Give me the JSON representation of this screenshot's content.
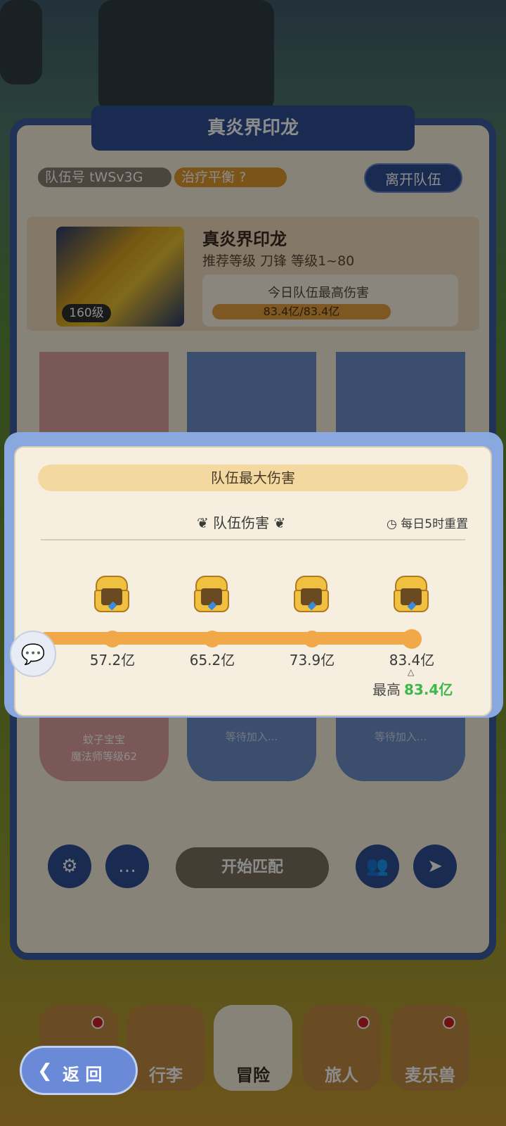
{
  "dungeon": {
    "title": "真炎界印龙"
  },
  "team": {
    "id_label": "队伍号",
    "id_value": "tWSv3G",
    "strategy": "治疗平衡",
    "strategy_help": "?",
    "leave_label": "离开队伍"
  },
  "boss": {
    "name": "真炎界印龙",
    "level": "160级",
    "recommend": "推荐等级    刀锋  等级1~80",
    "dmg_label": "今日队伍最高伤害",
    "dmg_value": "83.4亿/83.4亿"
  },
  "members": [
    {
      "name": "蚊子宝宝",
      "class_level": "魔法师等级62"
    },
    {
      "status": "等待加入..."
    },
    {
      "status": "等待加入..."
    }
  ],
  "actions": {
    "match_label": "开始匹配"
  },
  "nav": [
    {
      "label": ""
    },
    {
      "label": "行李"
    },
    {
      "label": "冒险"
    },
    {
      "label": "旅人"
    },
    {
      "label": "麦乐兽"
    }
  ],
  "modal": {
    "title": "队伍最大伤害",
    "subtitle": "队伍伤害",
    "reset": "每日5时重置",
    "milestones": [
      "57.2亿",
      "65.2亿",
      "73.9亿",
      "83.4亿"
    ],
    "max_label": "最高",
    "max_value": "83.4亿",
    "progress_percent": 100
  },
  "back_label": "返 回",
  "colors": {
    "accent": "#3b5c9e",
    "progress": "#f0a848",
    "max_highlight": "#3bb84a"
  }
}
